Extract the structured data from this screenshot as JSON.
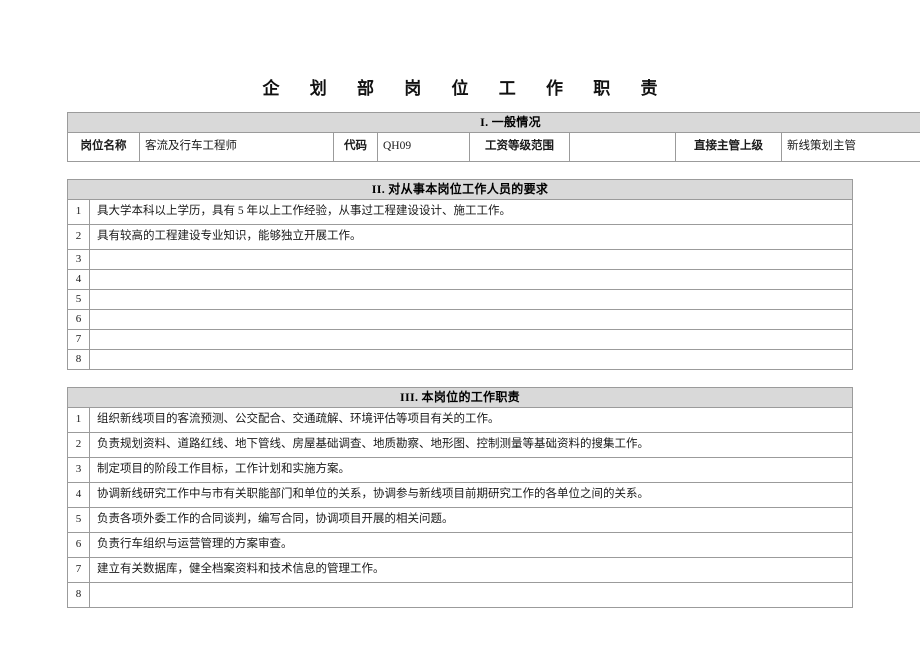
{
  "document": {
    "title": "企  划  部  岗  位  工  作  职  责"
  },
  "section_general": {
    "heading": "I.  一般情况",
    "fields": [
      {
        "label": "岗位名称",
        "value": "客流及行车工程师"
      },
      {
        "label": "代码",
        "value": "QH09"
      },
      {
        "label": "工资等级范围",
        "value": ""
      },
      {
        "label": "直接主管上级",
        "value": "新线策划主管"
      }
    ]
  },
  "section_requirements": {
    "heading": "II.  对从事本岗位工作人员的要求",
    "rows": [
      {
        "no": "1",
        "text": "具大学本科以上学历，具有 5 年以上工作经验，从事过工程建设设计、施工工作。"
      },
      {
        "no": "2",
        "text": "具有较高的工程建设专业知识，能够独立开展工作。"
      },
      {
        "no": "3",
        "text": ""
      },
      {
        "no": "4",
        "text": ""
      },
      {
        "no": "5",
        "text": ""
      },
      {
        "no": "6",
        "text": ""
      },
      {
        "no": "7",
        "text": ""
      },
      {
        "no": "8",
        "text": ""
      }
    ]
  },
  "section_duties": {
    "heading": "III.  本岗位的工作职责",
    "rows": [
      {
        "no": "1",
        "text": "组织新线项目的客流预测、公交配合、交通疏解、环境评估等项目有关的工作。"
      },
      {
        "no": "2",
        "text": "负责规划资料、道路红线、地下管线、房屋基础调查、地质勘察、地形图、控制测量等基础资料的搜集工作。"
      },
      {
        "no": "3",
        "text": "制定项目的阶段工作目标，工作计划和实施方案。"
      },
      {
        "no": "4",
        "text": "协调新线研究工作中与市有关职能部门和单位的关系，协调参与新线项目前期研究工作的各单位之间的关系。"
      },
      {
        "no": "5",
        "text": "负责各项外委工作的合同谈判，编写合同，协调项目开展的相关问题。"
      },
      {
        "no": "6",
        "text": "负责行车组织与运营管理的方案审查。"
      },
      {
        "no": "7",
        "text": "建立有关数据库，健全档案资料和技术信息的管理工作。"
      },
      {
        "no": "8",
        "text": ""
      }
    ]
  },
  "style": {
    "band_background": "#d9d9d9",
    "border_color": "#9b9b9b",
    "text_color": "#1a1a1a"
  }
}
